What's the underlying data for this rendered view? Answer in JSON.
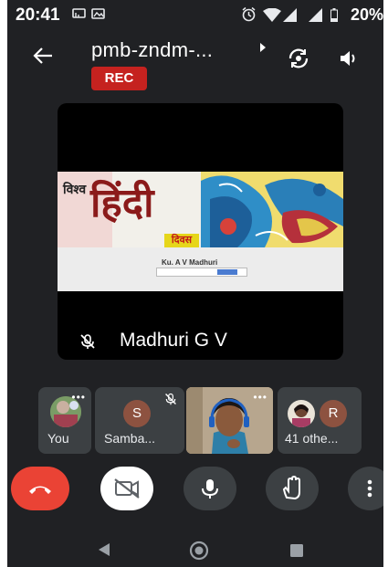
{
  "status_bar": {
    "time": "20:41",
    "battery": "20%",
    "icons": [
      "cast-icon",
      "gallery-icon",
      "alarm-icon",
      "wifi-icon",
      "signal-icon",
      "signal-icon",
      "battery-icon"
    ]
  },
  "header": {
    "title": "pmb-zndm-...",
    "rec_label": "REC"
  },
  "main_tile": {
    "participant_name": "Madhuri G V",
    "slide": {
      "line1": "विश्व",
      "line2": "हिंदी",
      "line3": "दिवस",
      "footer_name": "Ku. A V Madhuri"
    }
  },
  "thumbnails": [
    {
      "label": "You"
    },
    {
      "label": "Samba...",
      "initial": "S"
    },
    {
      "label": ""
    },
    {
      "label": "41 othe...",
      "initial": "R"
    }
  ],
  "controls": [
    "end-call",
    "camera-off",
    "microphone",
    "raise-hand",
    "more-options"
  ],
  "colors": {
    "background": "#202124",
    "rec": "#c5221f",
    "end_call": "#ea4335",
    "tile": "#3c4043"
  }
}
